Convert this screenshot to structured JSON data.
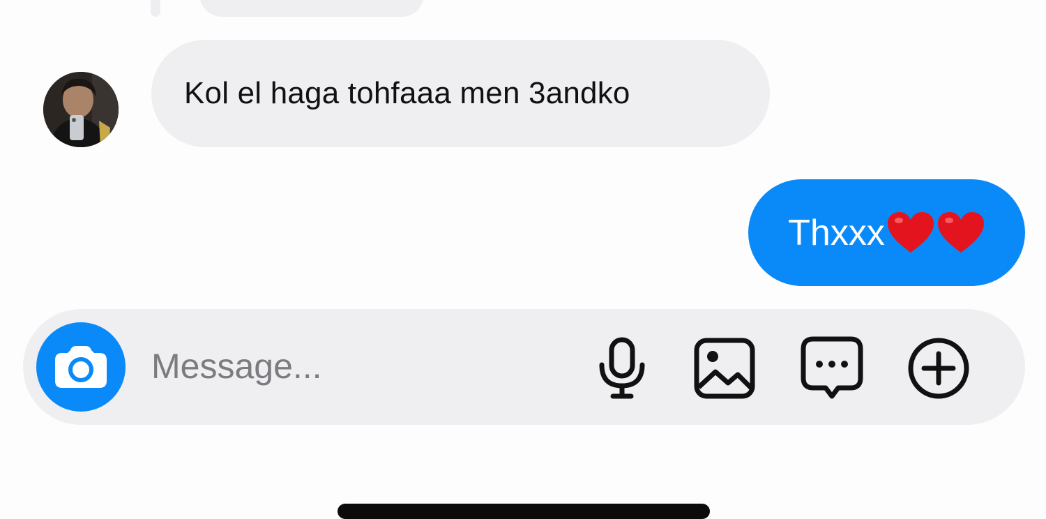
{
  "chat": {
    "messages": [
      {
        "direction": "incoming",
        "text": "Kol el haga tohfaaa men 3andko"
      },
      {
        "direction": "outgoing",
        "text": "Thxxx",
        "emoji": [
          "red-heart",
          "red-heart"
        ]
      }
    ]
  },
  "composer": {
    "placeholder": "Message...",
    "icons": [
      "camera-icon",
      "microphone-icon",
      "gallery-icon",
      "sticker-chat-icon",
      "plus-icon"
    ]
  },
  "colors": {
    "accent": "#0a8af8",
    "bubble_in": "#efeff1",
    "heart": "#e0101a"
  }
}
